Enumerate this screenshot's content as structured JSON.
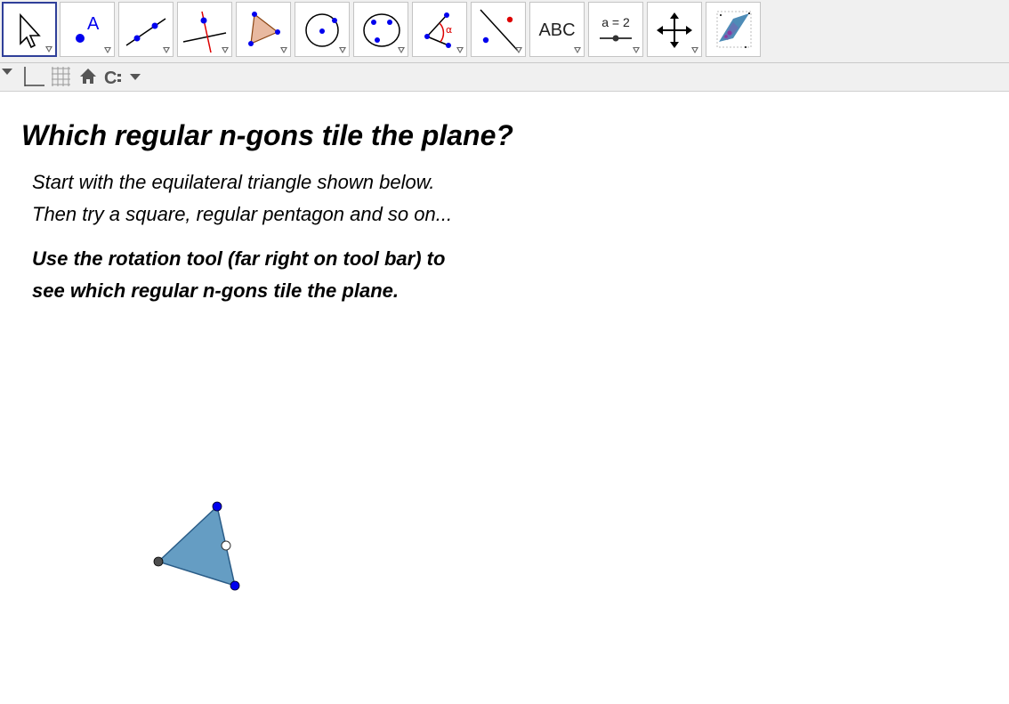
{
  "toolbar": {
    "tools": [
      {
        "name": "move-tool",
        "icon": "arrow-pointer-icon",
        "selected": true
      },
      {
        "name": "point-tool",
        "icon": "point-icon",
        "label": "A"
      },
      {
        "name": "line-tool",
        "icon": "line-through-points-icon"
      },
      {
        "name": "perpendicular-tool",
        "icon": "perpendicular-line-icon"
      },
      {
        "name": "polygon-tool",
        "icon": "polygon-icon"
      },
      {
        "name": "circle-tool",
        "icon": "circle-center-point-icon"
      },
      {
        "name": "conic-tool",
        "icon": "ellipse-icon"
      },
      {
        "name": "angle-tool",
        "icon": "angle-icon",
        "label": "α"
      },
      {
        "name": "reflect-tool",
        "icon": "reflect-about-line-icon"
      },
      {
        "name": "text-tool",
        "icon": "text-icon",
        "label": "ABC"
      },
      {
        "name": "slider-tool",
        "icon": "slider-icon",
        "label": "a = 2"
      },
      {
        "name": "move-graphics-tool",
        "icon": "move-graphics-view-icon"
      },
      {
        "name": "rotation-tool",
        "icon": "rotate-around-point-icon"
      }
    ]
  },
  "stylebar": {
    "items": [
      "toggle-menu-icon",
      "axes-icon",
      "grid-icon",
      "home-icon",
      "point-capture-icon"
    ]
  },
  "content": {
    "title": "Which regular n-gons tile the plane?",
    "line1": "Start with the equilateral triangle shown below.",
    "line2": "Then try a square, regular pentagon and so on...",
    "line3": "Use the rotation tool (far right on tool bar) to",
    "line4": "see which regular n-gons tile the plane."
  },
  "colors": {
    "triangle_fill": "#659dc3",
    "vertex_blue": "#0000ee",
    "vertex_dark": "#4d4d4d",
    "selected_border": "#2f3f99"
  }
}
